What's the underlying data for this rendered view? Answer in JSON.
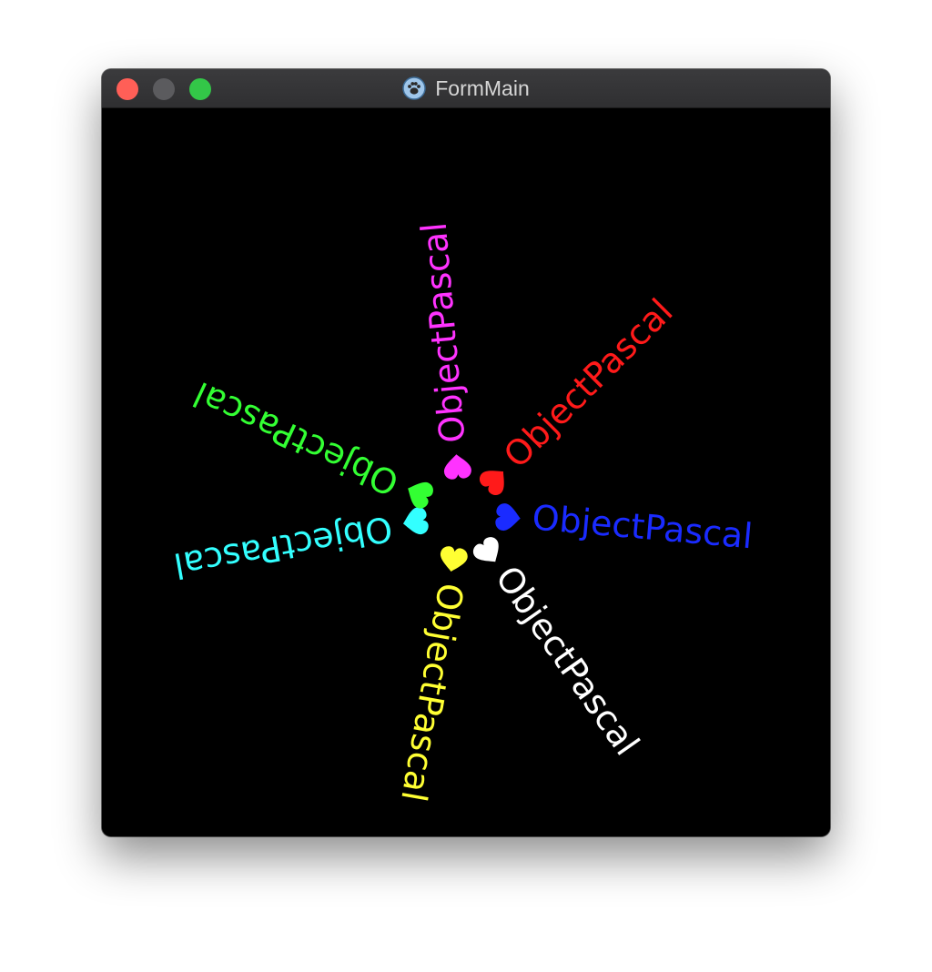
{
  "window": {
    "title": "FormMain",
    "app_icon": "lazarus-paw-icon",
    "controls": [
      "close",
      "minimize",
      "maximize"
    ]
  },
  "canvas": {
    "background": "#000000",
    "rays": [
      {
        "id": "red",
        "label": "ObjectPascal",
        "color": "#ff1a1a",
        "angle": -45
      },
      {
        "id": "blue",
        "label": "ObjectPascal",
        "color": "#1a2bff",
        "angle": 5
      },
      {
        "id": "white",
        "label": "ObjectPascal",
        "color": "#ffffff",
        "angle": 55
      },
      {
        "id": "yellow",
        "label": "ObjectPascal",
        "color": "#ffff33",
        "angle": 100
      },
      {
        "id": "cyan",
        "label": "ObjectPascal",
        "color": "#33ffff",
        "angle": 170
      },
      {
        "id": "green",
        "label": "ObjectPascal",
        "color": "#33ff33",
        "angle": 205
      },
      {
        "id": "magenta",
        "label": "ObjectPascal",
        "color": "#ff33ff",
        "angle": 265
      }
    ]
  }
}
